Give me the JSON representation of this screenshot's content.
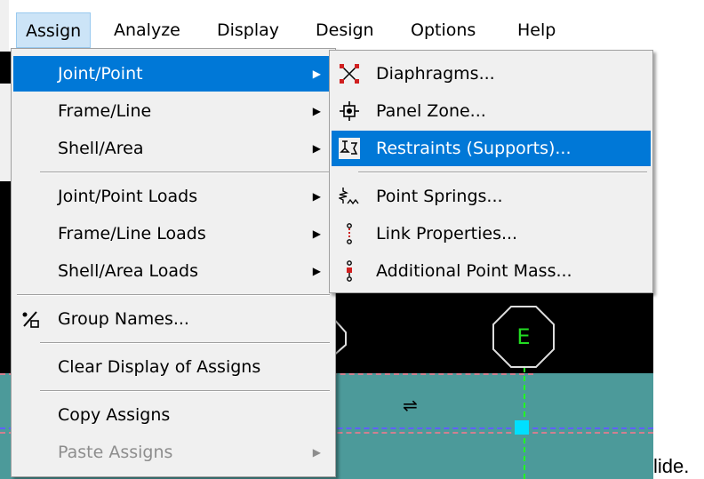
{
  "menubar": {
    "items": [
      {
        "label": "Assign"
      },
      {
        "label": "Analyze"
      },
      {
        "label": "Display"
      },
      {
        "label": "Design"
      },
      {
        "label": "Options"
      },
      {
        "label": "Help"
      }
    ]
  },
  "assign_menu": {
    "items": [
      {
        "label": "Joint/Point",
        "submenu": true,
        "highlighted": true
      },
      {
        "label": "Frame/Line",
        "submenu": true
      },
      {
        "label": "Shell/Area",
        "submenu": true
      },
      {
        "label": "Joint/Point Loads",
        "submenu": true
      },
      {
        "label": "Frame/Line Loads",
        "submenu": true
      },
      {
        "label": "Shell/Area Loads",
        "submenu": true
      },
      {
        "label": "Group Names...",
        "icon": "group-names-icon"
      },
      {
        "label": "Clear Display of Assigns"
      },
      {
        "label": "Copy Assigns"
      },
      {
        "label": "Paste Assigns",
        "submenu": true,
        "disabled": true
      }
    ]
  },
  "joint_submenu": {
    "items": [
      {
        "label": "Diaphragms...",
        "icon": "diaphragm-icon"
      },
      {
        "label": "Panel Zone...",
        "icon": "panel-zone-icon"
      },
      {
        "label": "Restraints (Supports)...",
        "icon": "restraints-icon",
        "highlighted": true
      },
      {
        "label": "Point Springs...",
        "icon": "point-springs-icon"
      },
      {
        "label": "Link Properties...",
        "icon": "link-properties-icon"
      },
      {
        "label": "Additional Point Mass...",
        "icon": "point-mass-icon"
      }
    ]
  },
  "canvas": {
    "grid_label": "E"
  },
  "trailing_text": "lide.",
  "colors": {
    "highlight": "#0078d7",
    "menu_bg": "#f0f0f0",
    "canvas_bg": "#000000",
    "teal": "#4c9a9a"
  }
}
